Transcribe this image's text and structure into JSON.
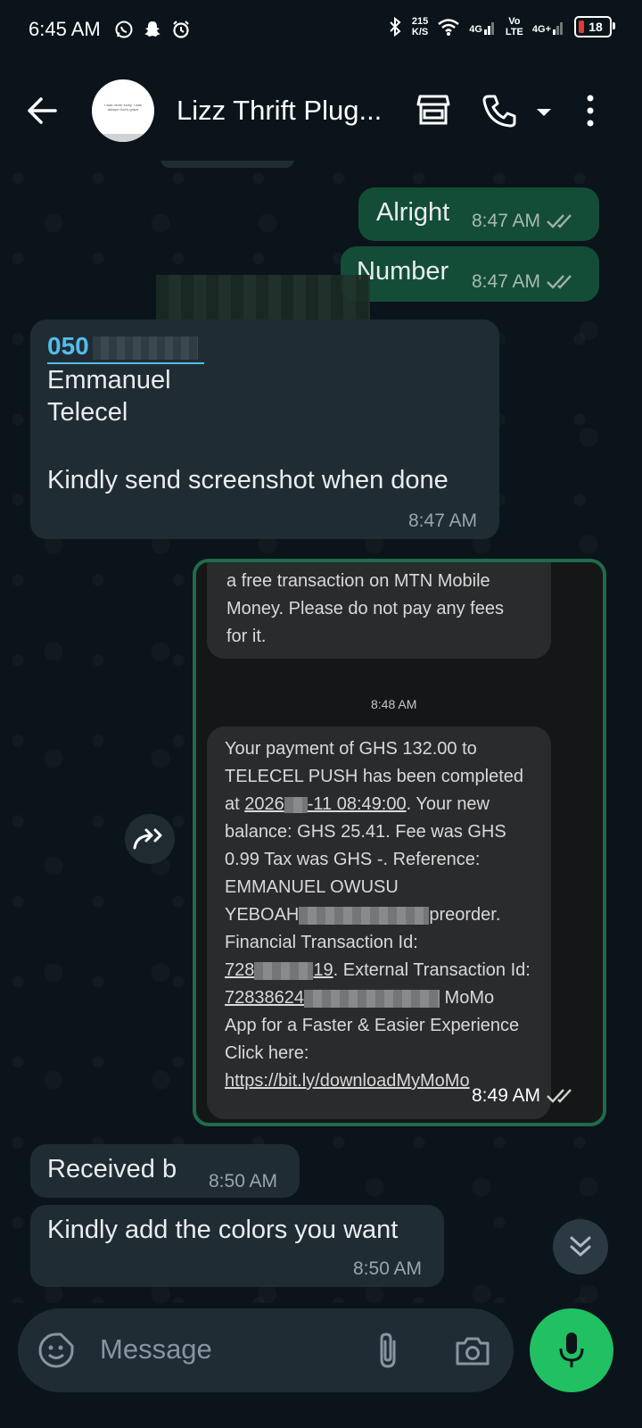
{
  "status_bar": {
    "time": "6:45 AM",
    "net_speed_value": "215",
    "net_speed_unit": "K/S",
    "net1": "4G",
    "volte_top": "Vo",
    "volte_bottom": "LTE",
    "net2": "4G+",
    "battery": "18",
    "left_icons": [
      "whatsapp-icon",
      "snapchat-icon",
      "alarm-icon"
    ],
    "right_icons": [
      "bluetooth-icon",
      "wifi-icon",
      "signal-icon",
      "signal-icon"
    ]
  },
  "header": {
    "contact_name": "Lizz Thrift Plug...",
    "avatar_text": "I was never lucky, I was always God's grace",
    "icons": [
      "back-arrow-icon",
      "store-icon",
      "phone-icon",
      "dropdown-icon",
      "more-vert-icon"
    ]
  },
  "messages": [
    {
      "id": "m1",
      "direction": "out",
      "text": "Alright",
      "time": "8:47 AM",
      "status": "read"
    },
    {
      "id": "m2",
      "direction": "out",
      "text": "Number",
      "time": "8:47 AM",
      "status": "read"
    },
    {
      "id": "m3",
      "direction": "in",
      "link": "050",
      "lines": [
        "Emmanuel",
        "Telecel",
        "",
        "Kindly send screenshot when done"
      ],
      "time": "8:47 AM"
    },
    {
      "id": "m4",
      "direction": "out",
      "type": "image",
      "time": "8:49 AM",
      "status": "read"
    },
    {
      "id": "m5",
      "direction": "in",
      "text": "Received b",
      "time": "8:50 AM"
    },
    {
      "id": "m6",
      "direction": "in",
      "text": "Kindly add the colors you want",
      "time": "8:50 AM"
    }
  ],
  "screenshot": {
    "card1_lines": [
      "a free transaction on MTN Mobile",
      "Money. Please do not pay any fees",
      "for it."
    ],
    "timestamp": "8:48 AM",
    "card2": {
      "l1": "Your payment of GHS 132.00 to",
      "l2": "TELECEL PUSH has been completed",
      "l3_pre": "at ",
      "l3_link_a": "2026",
      "l3_link_b": "-11 08:49:00",
      "l3_post": ". Your new",
      "l4": "balance: GHS 25.41. Fee was GHS",
      "l5": "0.99 Tax was GHS -. Reference:",
      "l6": "EMMANUEL OWUSU",
      "l7_pre": "YEBOAH",
      "l7_post": "preorder.",
      "l8": "Financial Transaction Id:",
      "l9_a": "728",
      "l9_b": "19",
      "l9_post": ". External Transaction Id:",
      "l10_a": "72838624",
      "l10_post": " MoMo",
      "l11": "App for a Faster & Easier Experience",
      "l12": "Click here:",
      "l13": "https://bit.ly/downloadMyMoMo"
    }
  },
  "composer": {
    "placeholder": "Message",
    "icons": [
      "emoji-sticker-icon",
      "attach-icon",
      "camera-icon",
      "mic-icon"
    ]
  },
  "colors": {
    "background": "#0b141a",
    "outgoing_bubble": "#144d37",
    "incoming_bubble": "#202c33",
    "link": "#53bdeb",
    "mic_button": "#21c063"
  }
}
